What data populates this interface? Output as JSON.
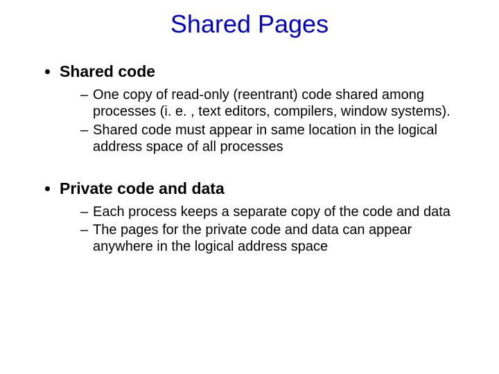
{
  "title": "Shared Pages",
  "sections": [
    {
      "heading": "Shared code",
      "items": [
        "One copy of read-only (reentrant) code shared among processes (i. e. , text editors, compilers, window systems).",
        "Shared code must appear in same location in the logical address space of all processes"
      ]
    },
    {
      "heading": "Private code and data",
      "items": [
        "Each process keeps a separate copy of the code and data",
        "The pages for the private code and data can appear anywhere in the logical address space"
      ]
    }
  ]
}
